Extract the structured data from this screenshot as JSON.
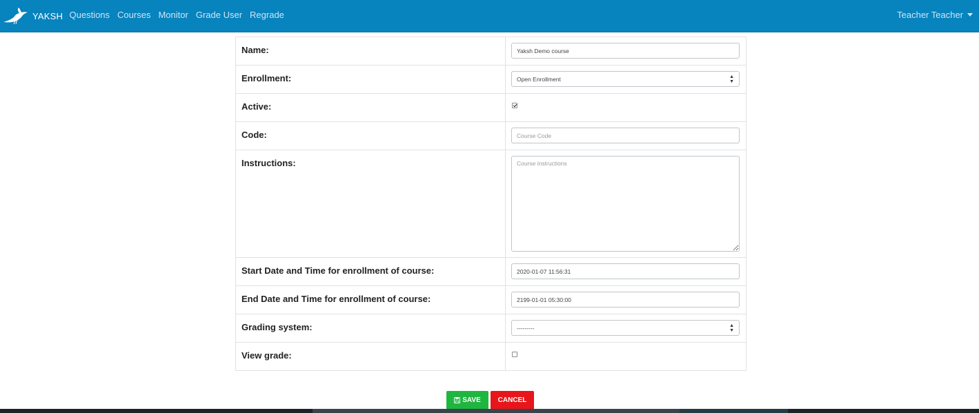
{
  "navbar": {
    "brand": "YAKSH",
    "links": [
      {
        "label": "Questions"
      },
      {
        "label": "Courses"
      },
      {
        "label": "Monitor"
      },
      {
        "label": "Grade User"
      },
      {
        "label": "Regrade"
      }
    ],
    "user": "Teacher Teacher"
  },
  "form": {
    "name": {
      "label": "Name:",
      "value": "Yaksh Demo course"
    },
    "enrollment": {
      "label": "Enrollment:",
      "value": "Open Enrollment"
    },
    "active": {
      "label": "Active:",
      "checked": true
    },
    "code": {
      "label": "Code:",
      "value": "",
      "placeholder": "Course Code"
    },
    "instructions": {
      "label": "Instructions:",
      "value": "",
      "placeholder": "Course instructions"
    },
    "start": {
      "label": "Start Date and Time for enrollment of course:",
      "value": "2020-01-07 11:56:31"
    },
    "end": {
      "label": "End Date and Time for enrollment of course:",
      "value": "2199-01-01 05:30:00"
    },
    "grading": {
      "label": "Grading system:",
      "value": "---------"
    },
    "view_grade": {
      "label": "View grade:",
      "checked": false
    }
  },
  "buttons": {
    "save": "SAVE",
    "cancel": "CANCEL"
  },
  "colors": {
    "navbar": "#0783be",
    "save": "#1fb63f",
    "cancel": "#e8151b"
  }
}
